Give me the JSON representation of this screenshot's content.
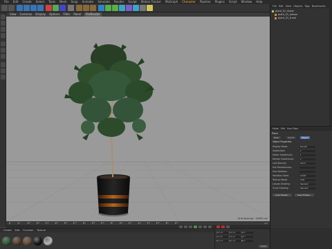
{
  "menubar": {
    "items": [
      "File",
      "Edit",
      "Create",
      "Select",
      "Tools",
      "Mesh",
      "Snap",
      "Animate",
      "Simulate",
      "Render",
      "Sculpt",
      "Motion Tracker",
      "MoGraph",
      "Character",
      "Pipeline",
      "Plugins",
      "Script",
      "Window",
      "Help"
    ],
    "highlight_index": 13
  },
  "viewport": {
    "menu": [
      "View",
      "Cameras",
      "Display",
      "Options",
      "Filter",
      "Panel",
      "ProRender"
    ],
    "active_index": 6,
    "info": "Grid Spacing : 10000 cm"
  },
  "timeline": {
    "ticks": [
      "0",
      "5",
      "10",
      "15",
      "20",
      "25",
      "30",
      "35",
      "40",
      "45",
      "50",
      "55",
      "60",
      "65",
      "70",
      "75",
      "80",
      "85",
      "90"
    ],
    "frame": "0 F"
  },
  "material_manager": {
    "menu": [
      "Create",
      "Edit",
      "Function",
      "Texture"
    ],
    "swatches": [
      {
        "name": "mat-1",
        "color": "#2e5a30"
      },
      {
        "name": "mat-2",
        "color": "#5a3d28"
      },
      {
        "name": "mat-3",
        "color": "#6b4a39"
      },
      {
        "name": "mat-4",
        "color": "#151515"
      },
      {
        "name": "mat-5",
        "color": "#b5b5b5"
      }
    ]
  },
  "coordinates": {
    "rows": [
      {
        "a": "X",
        "av": "0 cm",
        "b": "X",
        "bv": "0 cm",
        "c": "H",
        "cv": "0 °"
      },
      {
        "a": "Y",
        "av": "0 cm",
        "b": "Y",
        "bv": "0 cm",
        "c": "P",
        "cv": "0 °"
      },
      {
        "a": "Z",
        "av": "0 cm",
        "b": "Z",
        "bv": "0 cm",
        "c": "B",
        "cv": "0 °"
      }
    ],
    "apply": "Apply"
  },
  "object_manager": {
    "menu": [
      "File",
      "Edit",
      "View",
      "Objects",
      "Tags",
      "Bookmarks"
    ],
    "rows": [
      {
        "label": "plant_01_ready",
        "color": "#9ccf7a"
      },
      {
        "label": "plant_01_leaves",
        "color": "#d48a3a"
      },
      {
        "label": "plant_01_trunk",
        "color": "#d48a3a"
      }
    ]
  },
  "attributes": {
    "menu": [
      "Mode",
      "Edit",
      "User Data"
    ],
    "header": "Plant",
    "tabs": [
      "Basic",
      "Coord.",
      "Object"
    ],
    "active_tab": 2,
    "section": "Object Properties",
    "rows": [
      {
        "label": "Display Mode",
        "value": "Smooth"
      },
      {
        "label": "Subdivision",
        "value": "2"
      },
      {
        "label": "Editor Subdivision",
        "value": "1"
      },
      {
        "label": "Render Subdivision",
        "value": "2"
      },
      {
        "label": "Leaf Density",
        "value": "100 %"
      },
      {
        "label": "Use Randomness",
        "value": ""
      },
      {
        "label": "Use Variation",
        "value": ""
      },
      {
        "label": "Variation Seed",
        "value": "12345"
      },
      {
        "label": "Texture Mode",
        "value": "UVW"
      },
      {
        "label": "Leaves Shading",
        "value": "Standard"
      },
      {
        "label": "Trunk Shading",
        "value": "Standard"
      }
    ],
    "buttons": [
      "Load Preset...",
      "Save Preset..."
    ]
  }
}
